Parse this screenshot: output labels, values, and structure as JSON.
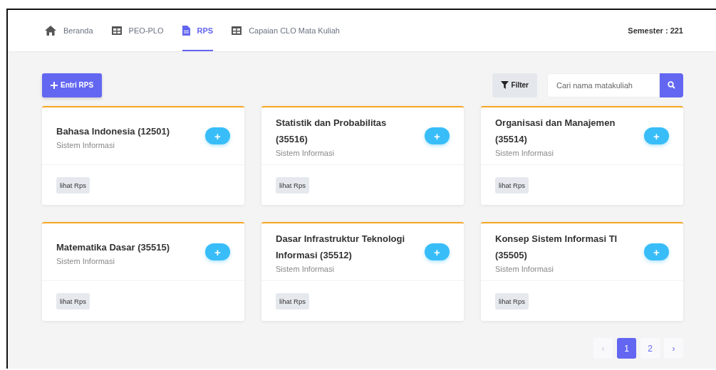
{
  "nav": {
    "items": [
      {
        "label": "Beranda",
        "kind": "home",
        "selected": false
      },
      {
        "label": "PEO-PLO",
        "kind": "table",
        "selected": false
      },
      {
        "label": "RPS",
        "kind": "file",
        "selected": true
      },
      {
        "label": "Capaian CLO Mata Kuliah",
        "kind": "table",
        "selected": false
      }
    ],
    "semester": "Semester : 221"
  },
  "toolbar": {
    "add_button": "Entri RPS",
    "filter_button": "Filter",
    "search": {
      "placeholder": "Cari nama matakuliah"
    }
  },
  "courses": [
    {
      "title": "Bahasa Indonesia (12501)",
      "program": "Sistem Informasi",
      "add_button": "+",
      "link": "lihat Rps"
    },
    {
      "title": "Statistik dan Probabilitas (35516)",
      "program": "Sistem Informasi",
      "add_button": "+",
      "link": "lihat Rps"
    },
    {
      "title": "Organisasi dan Manajemen (35514)",
      "program": "Sistem Informasi",
      "add_button": "+",
      "link": "lihat Rps"
    },
    {
      "title": "Matematika Dasar (35515)",
      "program": "Sistem Informasi",
      "add_button": "+",
      "link": "lihat Rps"
    },
    {
      "title": "Dasar Infrastruktur Teknologi Informasi (35512)",
      "program": "Sistem Informasi",
      "add_button": "+",
      "link": "lihat Rps"
    },
    {
      "title": "Konsep Sistem Informasi TI (35505)",
      "program": "Sistem Informasi",
      "add_button": "+",
      "link": "lihat Rps"
    }
  ],
  "pagination": [
    {
      "label": "‹",
      "selected": false,
      "disabled": true
    },
    {
      "label": "1",
      "selected": true,
      "disabled": false
    },
    {
      "label": "2",
      "selected": false,
      "disabled": false
    },
    {
      "label": "›",
      "selected": false,
      "disabled": false
    }
  ]
}
